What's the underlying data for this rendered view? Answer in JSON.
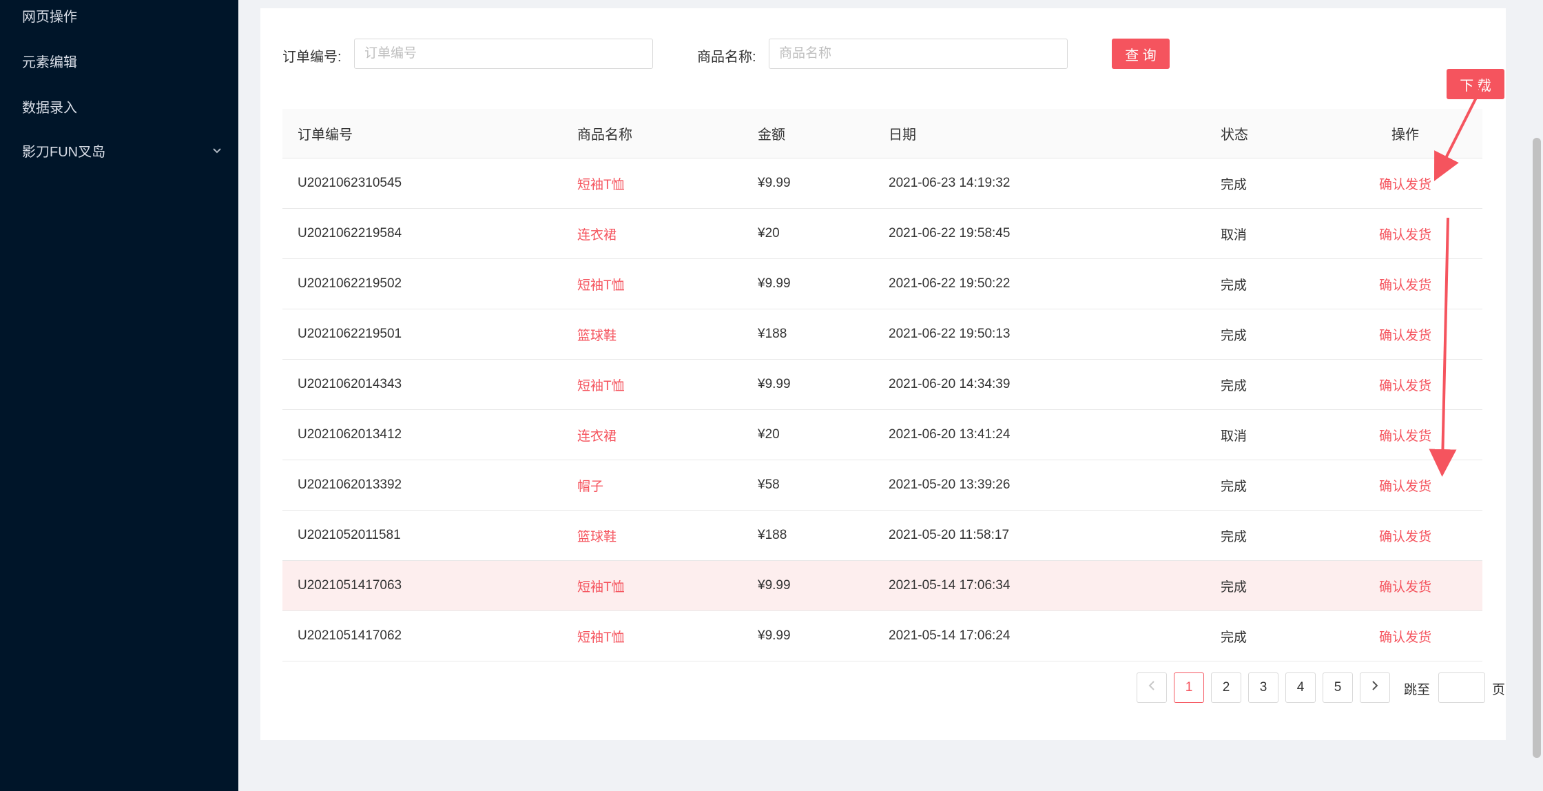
{
  "sidebar": {
    "items": [
      {
        "label": "网页操作"
      },
      {
        "label": "元素编辑"
      },
      {
        "label": "数据录入"
      },
      {
        "label": "影刀FUN叉岛",
        "has_submenu": true
      }
    ]
  },
  "search": {
    "order_label": "订单编号:",
    "order_placeholder": "订单编号",
    "name_label": "商品名称:",
    "name_placeholder": "商品名称",
    "query_button": "查 询"
  },
  "download_button": "下 载",
  "table": {
    "headers": [
      "订单编号",
      "商品名称",
      "金额",
      "日期",
      "状态",
      "操作"
    ],
    "rows": [
      {
        "id": "U2021062310545",
        "name": "短袖T恤",
        "amount": "¥9.99",
        "date": "2021-06-23 14:19:32",
        "status": "完成",
        "action": "确认发货"
      },
      {
        "id": "U2021062219584",
        "name": "连衣裙",
        "amount": "¥20",
        "date": "2021-06-22 19:58:45",
        "status": "取消",
        "action": "确认发货"
      },
      {
        "id": "U2021062219502",
        "name": "短袖T恤",
        "amount": "¥9.99",
        "date": "2021-06-22 19:50:22",
        "status": "完成",
        "action": "确认发货"
      },
      {
        "id": "U2021062219501",
        "name": "篮球鞋",
        "amount": "¥188",
        "date": "2021-06-22 19:50:13",
        "status": "完成",
        "action": "确认发货"
      },
      {
        "id": "U2021062014343",
        "name": "短袖T恤",
        "amount": "¥9.99",
        "date": "2021-06-20 14:34:39",
        "status": "完成",
        "action": "确认发货"
      },
      {
        "id": "U2021062013412",
        "name": "连衣裙",
        "amount": "¥20",
        "date": "2021-06-20 13:41:24",
        "status": "取消",
        "action": "确认发货"
      },
      {
        "id": "U2021062013392",
        "name": "帽子",
        "amount": "¥58",
        "date": "2021-05-20 13:39:26",
        "status": "完成",
        "action": "确认发货"
      },
      {
        "id": "U2021052011581",
        "name": "篮球鞋",
        "amount": "¥188",
        "date": "2021-05-20 11:58:17",
        "status": "完成",
        "action": "确认发货"
      },
      {
        "id": "U2021051417063",
        "name": "短袖T恤",
        "amount": "¥9.99",
        "date": "2021-05-14 17:06:34",
        "status": "完成",
        "action": "确认发货"
      },
      {
        "id": "U2021051417062",
        "name": "短袖T恤",
        "amount": "¥9.99",
        "date": "2021-05-14 17:06:24",
        "status": "完成",
        "action": "确认发货"
      }
    ]
  },
  "pagination": {
    "prev_icon": "chevron-left-icon",
    "next_icon": "chevron-right-icon",
    "pages": [
      "1",
      "2",
      "3",
      "4",
      "5"
    ],
    "current": "1",
    "jump_label": "跳至",
    "page_suffix": "页"
  },
  "colors": {
    "accent": "#f5545e",
    "sidebar_bg": "#001529",
    "highlight_row": "#fdeeee"
  }
}
